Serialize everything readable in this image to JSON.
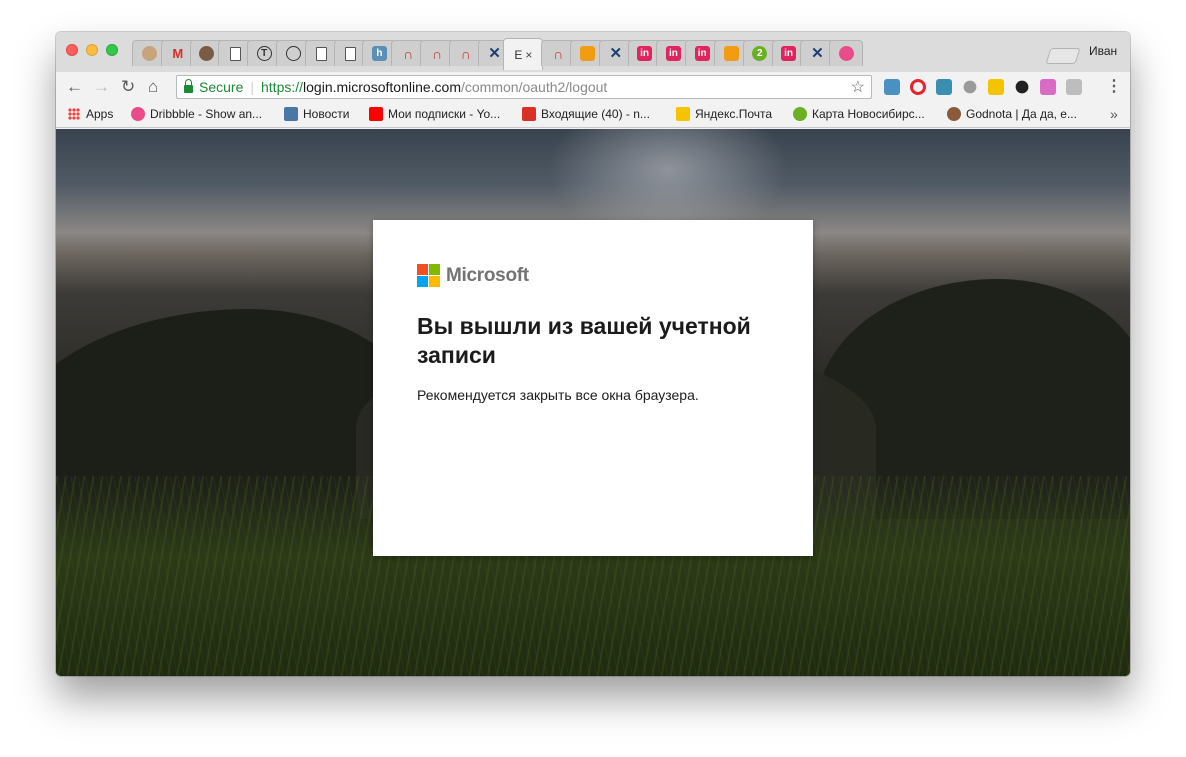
{
  "browser": {
    "profile_name": "Иван",
    "active_tab_label": "E",
    "tab_close_glyph": "×",
    "tabs": [
      {
        "icon": "fox-avatar-icon",
        "glyph": "",
        "color": "#c9a37a"
      },
      {
        "icon": "gmail-icon",
        "glyph": "M",
        "color": "#d93025"
      },
      {
        "icon": "cat-avatar-icon",
        "glyph": "",
        "color": "#7a5c44"
      },
      {
        "icon": "document-icon",
        "glyph": "",
        "color": "#ffffff"
      },
      {
        "icon": "t-circle-icon",
        "glyph": "T",
        "color": "#333333"
      },
      {
        "icon": "aperture-icon",
        "glyph": "",
        "color": "#333333"
      },
      {
        "icon": "document-icon",
        "glyph": "",
        "color": "#ffffff"
      },
      {
        "icon": "document-icon",
        "glyph": "",
        "color": "#ffffff"
      },
      {
        "icon": "h-icon",
        "glyph": "h",
        "color": "#5a8fb8"
      },
      {
        "icon": "arch-icon",
        "glyph": "∩",
        "color": "#c0392b"
      },
      {
        "icon": "arch-icon",
        "glyph": "∩",
        "color": "#c0392b"
      },
      {
        "icon": "arch-icon",
        "glyph": "∩",
        "color": "#c0392b"
      },
      {
        "icon": "x-tools-icon",
        "glyph": "✕",
        "color": "#1d3f73"
      },
      {
        "icon": "arch-icon",
        "glyph": "∩",
        "color": "#c0392b"
      },
      {
        "icon": "orange-grid-icon",
        "glyph": "",
        "color": "#f39c12"
      },
      {
        "icon": "x-tools-icon",
        "glyph": "✕",
        "color": "#1d3f73"
      },
      {
        "icon": "invision-icon",
        "glyph": "in",
        "color": "#e0245e"
      },
      {
        "icon": "invision-icon",
        "glyph": "in",
        "color": "#e0245e"
      },
      {
        "icon": "invision-icon",
        "glyph": "in",
        "color": "#e0245e"
      },
      {
        "icon": "orange-grid-icon",
        "glyph": "",
        "color": "#f39c12"
      },
      {
        "icon": "2gis-icon",
        "glyph": "2",
        "color": "#6ab023"
      },
      {
        "icon": "invision-icon",
        "glyph": "in",
        "color": "#e0245e"
      },
      {
        "icon": "x-tools-icon",
        "glyph": "✕",
        "color": "#1d3f73"
      },
      {
        "icon": "dribbble-icon",
        "glyph": "",
        "color": "#ea4c89"
      }
    ]
  },
  "toolbar": {
    "back_glyph": "←",
    "forward_glyph": "→",
    "reload_glyph": "↻",
    "home_glyph": "⌂",
    "secure_label": "Secure",
    "separator": "|",
    "url_scheme": "https://",
    "url_host": "login.microsoftonline.com",
    "url_path": "/common/oauth2/logout",
    "bookmark_star": "☆",
    "menu_glyph": "⋮",
    "extensions": [
      {
        "icon": "note-extension-icon",
        "color": "#4a90c2"
      },
      {
        "icon": "opera-icon",
        "color": "#e3262e"
      },
      {
        "icon": "triangle-extension-icon",
        "color": "#3a8fb0"
      },
      {
        "icon": "paw-extension-icon",
        "color": "#9a9a9a"
      },
      {
        "icon": "bulb-extension-icon",
        "color": "#f5c400"
      },
      {
        "icon": "bird-extension-icon",
        "color": "#222222"
      },
      {
        "icon": "gradient-extension-icon",
        "color": "#d96bc4"
      },
      {
        "icon": "chat-extension-icon",
        "color": "#bdbdbd"
      }
    ]
  },
  "bookmarks": {
    "more_glyph": "»",
    "items": [
      {
        "label": "Apps",
        "icon": "apps-grid-icon",
        "color": "#e44c3c"
      },
      {
        "label": "Dribbble - Show an...",
        "icon": "dribbble-icon",
        "color": "#ea4c89"
      },
      {
        "label": "Новости",
        "icon": "vk-icon",
        "color": "#4a76a8"
      },
      {
        "label": "Мои подписки - Yo...",
        "icon": "youtube-icon",
        "color": "#ff0000"
      },
      {
        "label": "Входящие (40) - n...",
        "icon": "gmail-icon",
        "color": "#d93025"
      },
      {
        "label": "Яндекс.Почта",
        "icon": "yandex-mail-icon",
        "color": "#f5c400"
      },
      {
        "label": "Карта Новосибирс...",
        "icon": "2gis-icon",
        "color": "#6ab023"
      },
      {
        "label": "Godnota | Да да, е...",
        "icon": "donut-icon",
        "color": "#8a5a3a"
      }
    ]
  },
  "page": {
    "brand_name": "Microsoft",
    "logo_colors": [
      "#f25022",
      "#7fba00",
      "#00a4ef",
      "#ffb900"
    ],
    "heading": "Вы вышли из вашей учетной записи",
    "message": "Рекомендуется закрыть все окна браузера."
  }
}
